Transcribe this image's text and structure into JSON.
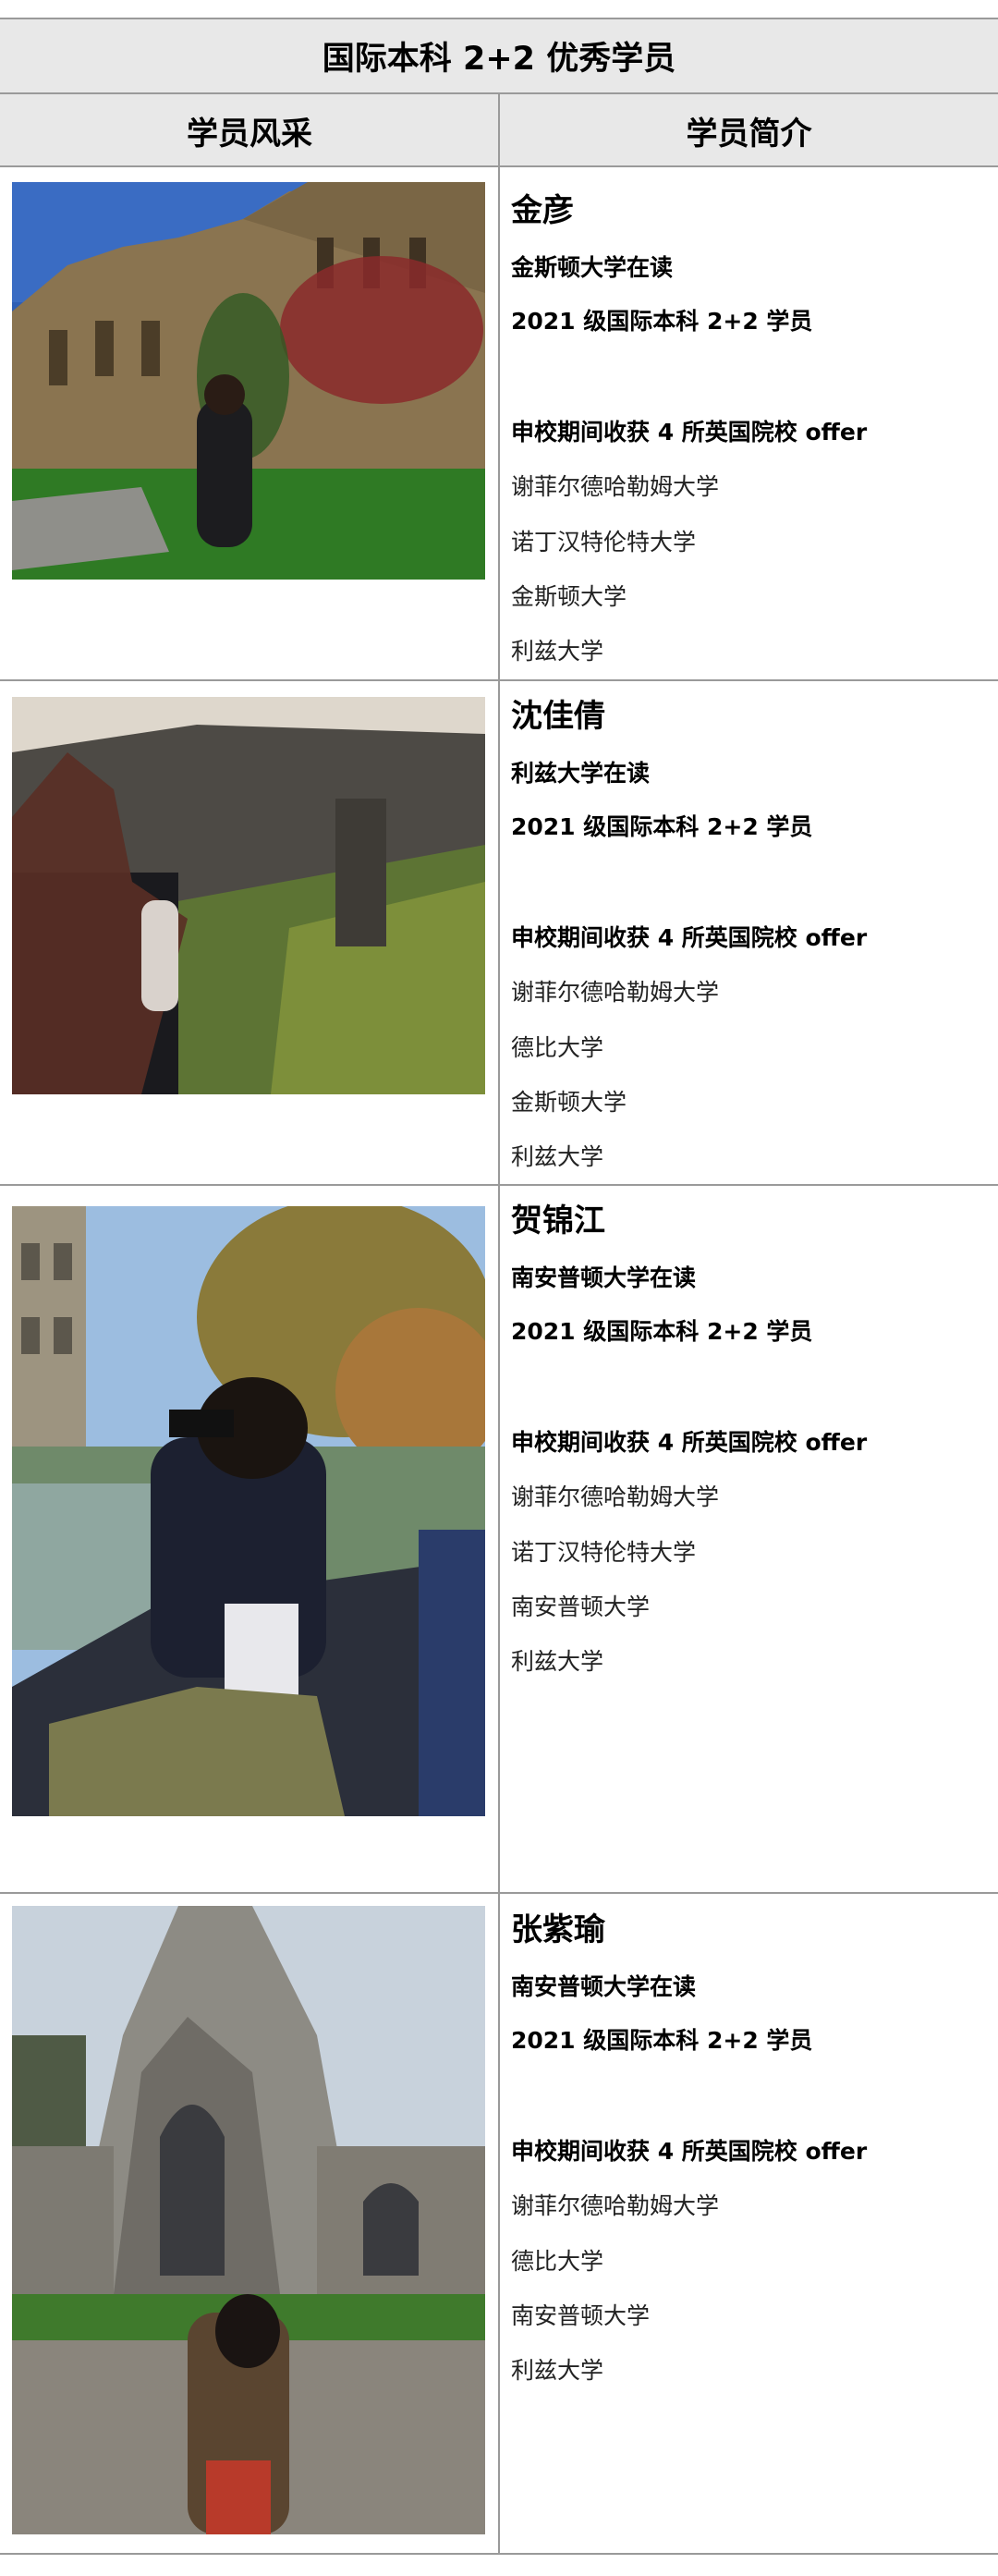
{
  "table": {
    "title": "国际本科 2+2 优秀学员",
    "headers": {
      "photos": "学员风采",
      "profile": "学员简介"
    }
  },
  "students": [
    {
      "name": "金彦",
      "status": "金斯顿大学在读",
      "cohort": "2021 级国际本科 2+2 学员",
      "offers_heading": "申校期间收获 4 所英国院校 offer",
      "offers": [
        "谢菲尔德哈勒姆大学",
        "诺丁汉特伦特大学",
        "金斯顿大学",
        "利兹大学"
      ]
    },
    {
      "name": "沈佳倩",
      "status": "利兹大学在读",
      "cohort": "2021 级国际本科 2+2 学员",
      "offers_heading": "申校期间收获 4 所英国院校 offer",
      "offers": [
        "谢菲尔德哈勒姆大学",
        "德比大学",
        "金斯顿大学",
        "利兹大学"
      ]
    },
    {
      "name": "贺锦江",
      "status": "南安普顿大学在读",
      "cohort": "2021 级国际本科 2+2 学员",
      "offers_heading": "申校期间收获 4 所英国院校 offer",
      "offers": [
        "谢菲尔德哈勒姆大学",
        "诺丁汉特伦特大学",
        "南安普顿大学",
        "利兹大学"
      ]
    },
    {
      "name": "张紫瑜",
      "status": "南安普顿大学在读",
      "cohort": "2021 级国际本科 2+2 学员",
      "offers_heading": "申校期间收获 4 所英国院校 offer",
      "offers": [
        "谢菲尔德哈勒姆大学",
        "德比大学",
        "南安普顿大学",
        "利兹大学"
      ]
    }
  ]
}
